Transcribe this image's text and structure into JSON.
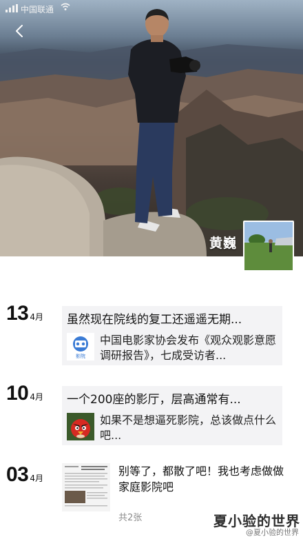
{
  "status_bar": {
    "carrier": "中国联通"
  },
  "profile": {
    "name": "黄巍"
  },
  "posts": [
    {
      "day": "13",
      "month": "4月",
      "title": "虽然现在院线的复工还遥遥无期...",
      "link_text": "中国电影家协会发布《观众观影意愿调研报告》，七成受访者...",
      "thumb_caption": "影院"
    },
    {
      "day": "10",
      "month": "4月",
      "title": "一个200座的影厅，层高通常有...",
      "link_text": "如果不是想逼死影院，总该做点什么吧..."
    },
    {
      "day": "03",
      "month": "4月",
      "text": "别等了，都散了吧！我也考虑做做家庭影院吧",
      "count": "共2张"
    }
  ],
  "watermark": {
    "title": "夏小验的世界",
    "sub": "@夏小验的世界"
  }
}
